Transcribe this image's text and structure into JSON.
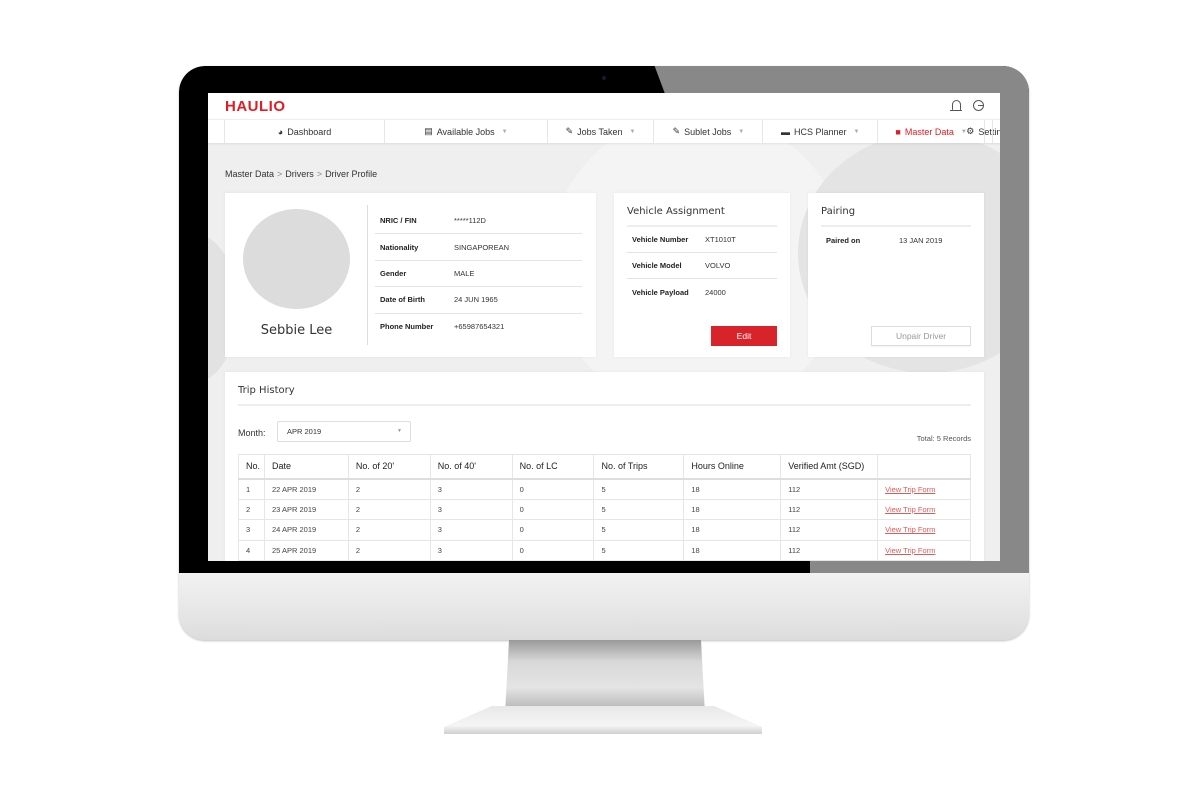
{
  "app": {
    "logo": "HAULIO",
    "top_icons": [
      "bell-icon",
      "logout-icon"
    ],
    "accent_color": "#e21c23"
  },
  "nav": {
    "items": [
      {
        "label": "Dashboard",
        "icon": "dashboard-icon",
        "glyph": "◕",
        "dropdown": false,
        "active": false
      },
      {
        "label": "Available Jobs",
        "icon": "jobs-icon",
        "glyph": "▤",
        "dropdown": true,
        "active": false
      },
      {
        "label": "Jobs Taken",
        "icon": "pen-icon",
        "glyph": "✎",
        "dropdown": true,
        "active": false
      },
      {
        "label": "Sublet Jobs",
        "icon": "pen-icon",
        "glyph": "✎",
        "dropdown": true,
        "active": false
      },
      {
        "label": "HCS Planner",
        "icon": "truck-icon",
        "glyph": "▬",
        "dropdown": true,
        "active": false
      },
      {
        "label": "Master Data",
        "icon": "file-icon",
        "glyph": "■",
        "dropdown": true,
        "active": true
      },
      {
        "label": "Settings",
        "icon": "gear-icon",
        "glyph": "⚙",
        "dropdown": false,
        "active": false
      }
    ]
  },
  "breadcrumb": [
    "Master Data",
    "Drivers",
    "Driver Profile"
  ],
  "breadcrumb_sep": ">",
  "profile": {
    "name": "Sebbie Lee",
    "fields": [
      {
        "label": "NRIC / FIN",
        "value": "*****112D"
      },
      {
        "label": "Nationality",
        "value": "SINGAPOREAN"
      },
      {
        "label": "Gender",
        "value": "MALE"
      },
      {
        "label": "Date of Birth",
        "value": "24 JUN 1965"
      },
      {
        "label": "Phone Number",
        "value": "+65987654321"
      }
    ]
  },
  "vehicle": {
    "title": "Vehicle Assignment",
    "fields": [
      {
        "label": "Vehicle Number",
        "value": "XT1010T"
      },
      {
        "label": "Vehicle Model",
        "value": "VOLVO"
      },
      {
        "label": "Vehicle Payload",
        "value": "24000"
      }
    ],
    "edit_label": "Edit"
  },
  "pairing": {
    "title": "Pairing",
    "fields": [
      {
        "label": "Paired on",
        "value": "13 JAN 2019"
      }
    ],
    "unpair_label": "Unpair Driver"
  },
  "trip_history": {
    "title": "Trip History",
    "month_label": "Month:",
    "month_value": "APR 2019",
    "total": "Total: 5 Records",
    "columns": [
      "No.",
      "Date",
      "No. of 20'",
      "No. of 40'",
      "No. of LC",
      "No. of Trips",
      "Hours Online",
      "Verified Amt (SGD)",
      ""
    ],
    "rows": [
      [
        "1",
        "22 APR 2019",
        "2",
        "3",
        "0",
        "5",
        "18",
        "112",
        "View Trip Form"
      ],
      [
        "2",
        "23 APR 2019",
        "2",
        "3",
        "0",
        "5",
        "18",
        "112",
        "View Trip Form"
      ],
      [
        "3",
        "24 APR 2019",
        "2",
        "3",
        "0",
        "5",
        "18",
        "112",
        "View Trip Form"
      ],
      [
        "4",
        "25 APR 2019",
        "2",
        "3",
        "0",
        "5",
        "18",
        "112",
        "View Trip Form"
      ]
    ]
  }
}
